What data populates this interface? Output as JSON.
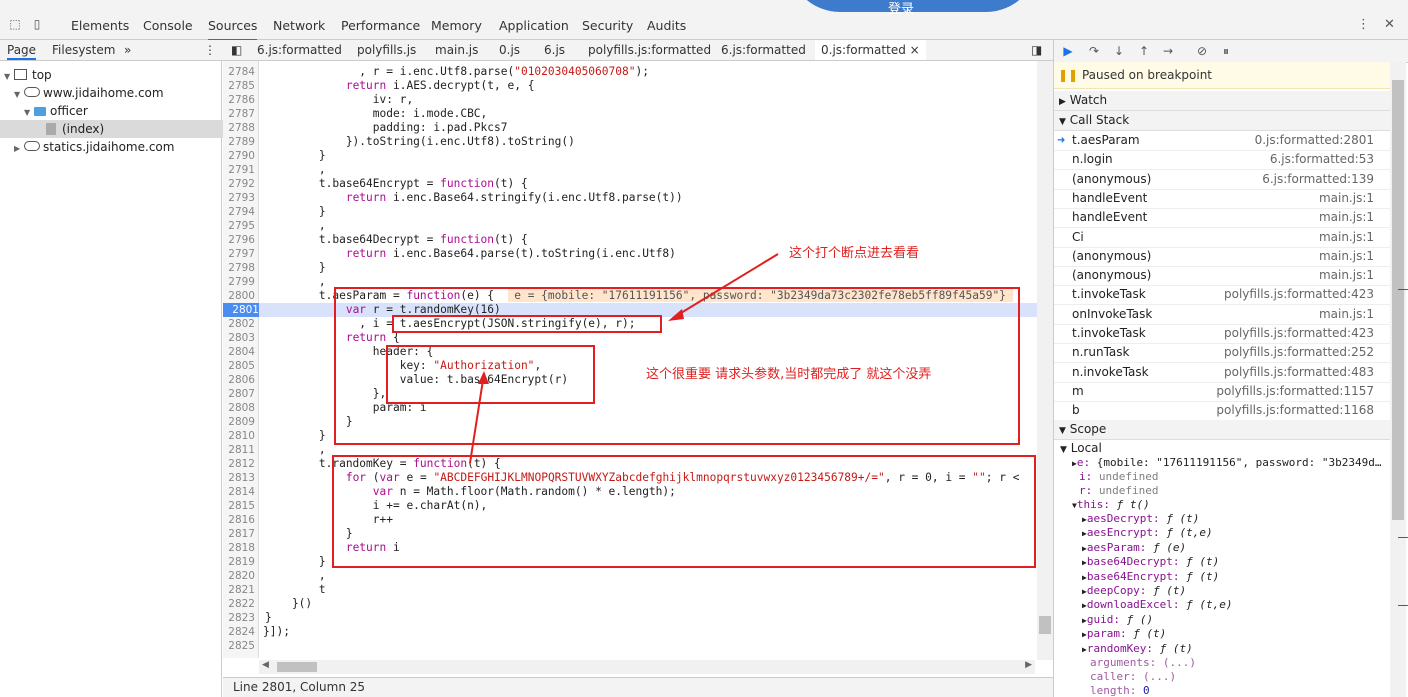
{
  "toolbar": {
    "banner_text": "登录",
    "tabs": [
      "Elements",
      "Console",
      "Sources",
      "Network",
      "Performance",
      "Memory",
      "Application",
      "Security",
      "Audits"
    ],
    "active_tab": "Sources",
    "more_label": "⋮",
    "close_label": "✕"
  },
  "navigator": {
    "tabs": [
      "Page",
      "Filesystem"
    ],
    "overflow": "»",
    "tree": [
      {
        "label": "top"
      },
      {
        "label": "www.jidaihome.com"
      },
      {
        "label": "officer"
      },
      {
        "label": "(index)"
      },
      {
        "label": "statics.jidaihome.com"
      }
    ]
  },
  "file_tabs": [
    "6.js:formatted",
    "polyfills.js",
    "main.js",
    "0.js",
    "6.js",
    "polyfills.js:formatted",
    "6.js:formatted",
    "0.js:formatted"
  ],
  "active_file_close": "×",
  "editor": {
    "line_numbers": [
      "2784",
      "2785",
      "2786",
      "2787",
      "2788",
      "2789",
      "2790",
      "2791",
      "2792",
      "2793",
      "2794",
      "2795",
      "2796",
      "2797",
      "2798",
      "2799",
      "2800",
      "2801",
      "2802",
      "2803",
      "2804",
      "2805",
      "2806",
      "2807",
      "2808",
      "2809",
      "2810",
      "2811",
      "2812",
      "2813",
      "2814",
      "2815",
      "2816",
      "2817",
      "2818",
      "2819",
      "2820",
      "2821",
      "2822",
      "2823",
      "2824",
      "2825"
    ],
    "lines": {
      "l2784": "              , r = i.enc.Utf8.parse(",
      "l2784s": "\"0102030405060708\"",
      "l2784e": ");",
      "l2785a": "            ",
      "l2785k": "return",
      "l2785b": " i.AES.decrypt(t, e, {",
      "l2786": "                iv: r,",
      "l2787": "                mode: i.mode.CBC,",
      "l2788": "                padding: i.pad.Pkcs7",
      "l2789": "            }).toString(i.enc.Utf8).toString()",
      "l2790": "        }",
      "l2791": "        ,",
      "l2792a": "        t.base64Encrypt = ",
      "l2792k": "function",
      "l2792b": "(t) {",
      "l2793k": "return",
      "l2793b": " i.enc.Base64.stringify(i.enc.Utf8.parse(t))",
      "l2794": "        }",
      "l2795": "        ,",
      "l2796a": "        t.base64Decrypt = ",
      "l2796k": "function",
      "l2796b": "(t) {",
      "l2797k": "return",
      "l2797b": " i.enc.Base64.parse(t).toString(i.enc.Utf8)",
      "l2798": "        }",
      "l2799": "        ,",
      "l2800a": "        t.aesParam = ",
      "l2800k": "function",
      "l2800b": "(e) {  ",
      "l2800inl": " e = {mobile: \"17611191156\", password: \"3b2349da73c2302fe78eb5ff89f45a59\"} ",
      "l2801k": "var",
      "l2801b": " r = t.randomKey(16)",
      "l2802": "              , i = t.aesEncrypt(JSON.stringify(e), r);",
      "l2803k": "return",
      "l2803b": " {",
      "l2804": "                header: {",
      "l2805a": "                    key: ",
      "l2805s": "\"Authorization\"",
      "l2805b": ",",
      "l2806": "                    value: t.base64Encrypt(r)",
      "l2807": "                },",
      "l2808": "                param: i",
      "l2809": "            }",
      "l2810": "        }",
      "l2811": "        ,",
      "l2812a": "        t.randomKey = ",
      "l2812k": "function",
      "l2812b": "(t) {",
      "l2813a": "            ",
      "l2813k": "for",
      "l2813b": " (",
      "l2813k2": "var",
      "l2813c": " e = ",
      "l2813s": "\"ABCDEFGHIJKLMNOPQRSTUVWXYZabcdefghijklmnopqrstuvwxyz0123456789+/=\"",
      "l2813d": ", r = 0, i = ",
      "l2813s2": "\"\"",
      "l2813e": "; r <",
      "l2814k": "var",
      "l2814b": " n = Math.floor(Math.random() * e.length);",
      "l2815": "                i += e.charAt(n),",
      "l2816": "                r++",
      "l2817": "            }",
      "l2818k": "return",
      "l2818b": " i",
      "l2819": "        }",
      "l2820": "        ,",
      "l2821": "        t",
      "l2822": "    }()",
      "l2823": "}",
      "l2824": "}]);"
    }
  },
  "annotations": {
    "note1": "这个打个断点进去看看",
    "note2": "这个很重要 请求头参数,当时都完成了  就这个没弄"
  },
  "status": {
    "position": "Line 2801, Column 25"
  },
  "debugger": {
    "paused": "Paused on breakpoint",
    "watch": "Watch",
    "call_stack": "Call Stack",
    "frames": [
      {
        "fn": "t.aesParam",
        "loc": "0.js:formatted:2801"
      },
      {
        "fn": "n.login",
        "loc": "6.js:formatted:53"
      },
      {
        "fn": "(anonymous)",
        "loc": "6.js:formatted:139"
      },
      {
        "fn": "handleEvent",
        "loc": "main.js:1"
      },
      {
        "fn": "handleEvent",
        "loc": "main.js:1"
      },
      {
        "fn": "Ci",
        "loc": "main.js:1"
      },
      {
        "fn": "(anonymous)",
        "loc": "main.js:1"
      },
      {
        "fn": "(anonymous)",
        "loc": "main.js:1"
      },
      {
        "fn": "t.invokeTask",
        "loc": "polyfills.js:formatted:423"
      },
      {
        "fn": "onInvokeTask",
        "loc": "main.js:1"
      },
      {
        "fn": "t.invokeTask",
        "loc": "polyfills.js:formatted:423"
      },
      {
        "fn": "n.runTask",
        "loc": "polyfills.js:formatted:252"
      },
      {
        "fn": "n.invokeTask",
        "loc": "polyfills.js:formatted:483"
      },
      {
        "fn": "m",
        "loc": "polyfills.js:formatted:1157"
      },
      {
        "fn": "b",
        "loc": "polyfills.js:formatted:1168"
      }
    ],
    "scope": "Scope",
    "local": "Local",
    "scope_items": {
      "e_key": "e: ",
      "e_val": "{mobile: \"17611191156\", password: \"3b2349d…",
      "i_key": "i: ",
      "i_val": "undefined",
      "r_key": "r: ",
      "r_val": "undefined",
      "this_key": "this: ",
      "this_val": "ƒ t()",
      "members": [
        {
          "k": "aesDecrypt: ",
          "v": "ƒ (t)"
        },
        {
          "k": "aesEncrypt: ",
          "v": "ƒ (t,e)"
        },
        {
          "k": "aesParam: ",
          "v": "ƒ (e)"
        },
        {
          "k": "base64Decrypt: ",
          "v": "ƒ (t)"
        },
        {
          "k": "base64Encrypt: ",
          "v": "ƒ (t)"
        },
        {
          "k": "deepCopy: ",
          "v": "ƒ (t)"
        },
        {
          "k": "downloadExcel: ",
          "v": "ƒ (t,e)"
        },
        {
          "k": "guid: ",
          "v": "ƒ ()"
        },
        {
          "k": "param: ",
          "v": "ƒ (t)"
        },
        {
          "k": "randomKey: ",
          "v": "ƒ (t)"
        }
      ],
      "arguments": "arguments: (...)",
      "caller": "caller: (...)",
      "length_k": "length: ",
      "length_v": "0"
    }
  }
}
